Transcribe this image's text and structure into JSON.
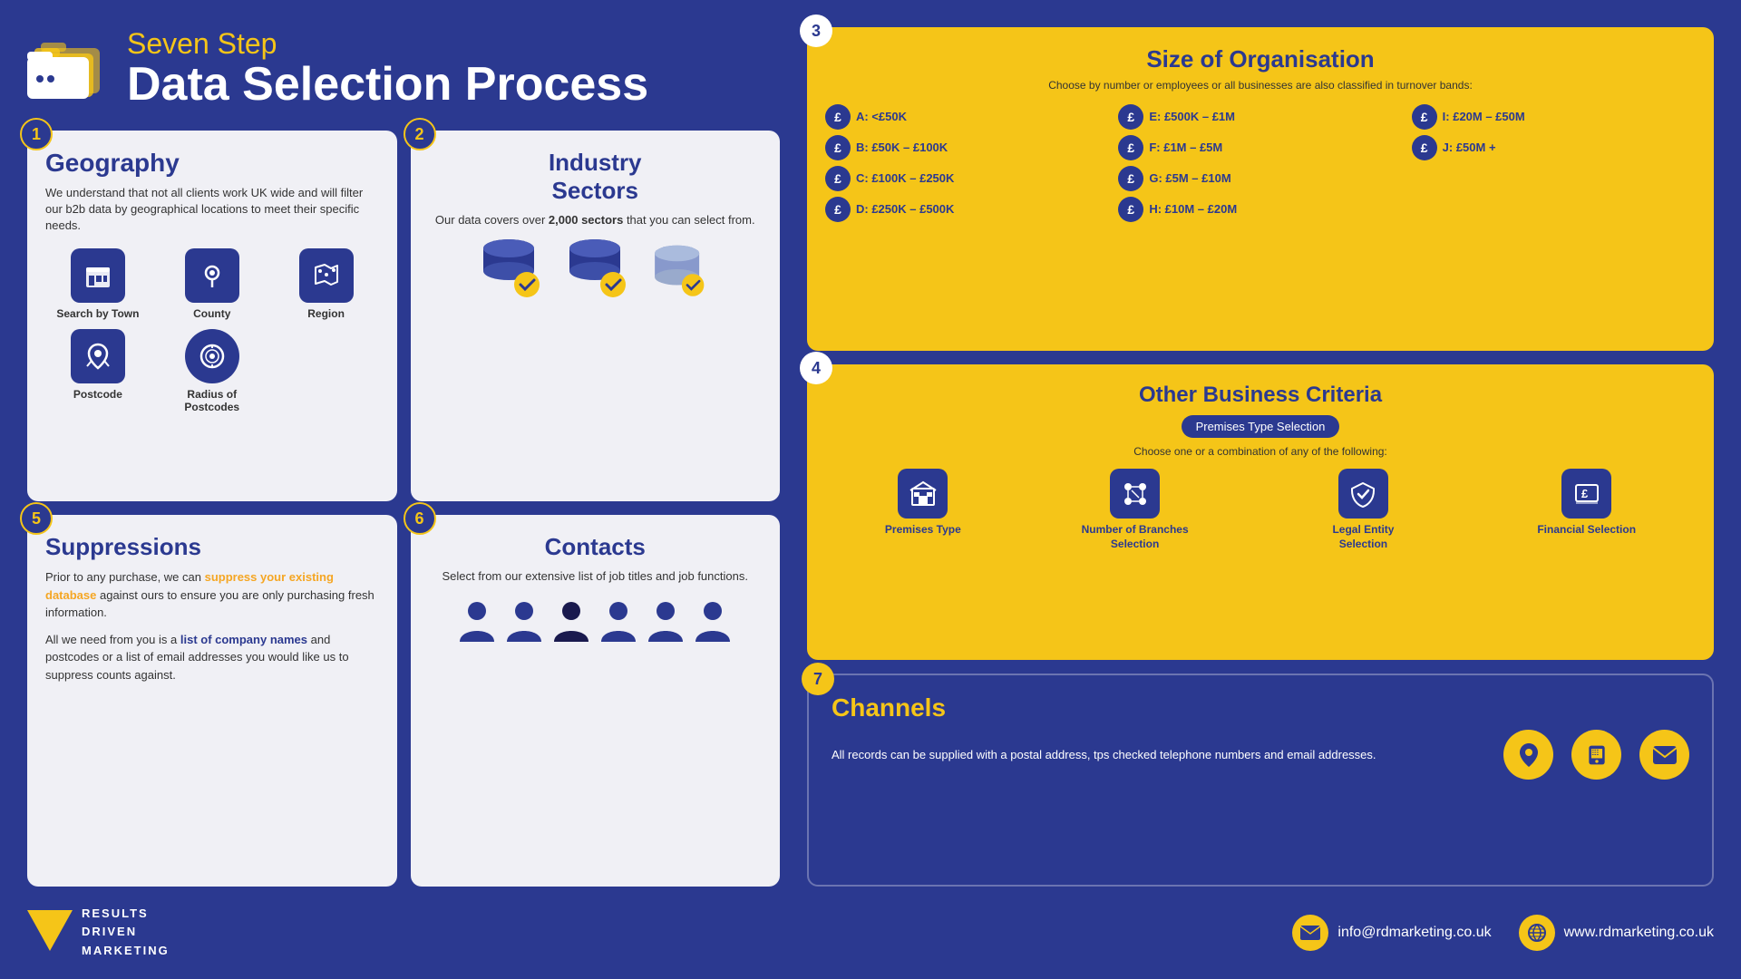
{
  "header": {
    "subtitle": "Seven Step",
    "title": "Data Selection Process"
  },
  "step1": {
    "number": "1",
    "title": "Geography",
    "description": "We understand that not all clients work UK wide and will filter our b2b data by geographical locations to meet their specific needs.",
    "icons": [
      {
        "label": "Search by Town",
        "icon": "🏢"
      },
      {
        "label": "County",
        "icon": "📍"
      },
      {
        "label": "Region",
        "icon": "🗺"
      },
      {
        "label": "Postcode",
        "icon": "📮"
      },
      {
        "label": "Radius of Postcodes",
        "icon": "🎯"
      }
    ]
  },
  "step2": {
    "number": "2",
    "title": "Industry Sectors",
    "description": "Our data covers over 2,000 sectors that you can select from."
  },
  "step3": {
    "number": "3",
    "title": "Size of Organisation",
    "subtitle": "Choose by number or employees or all businesses are also classified in turnover bands:",
    "bands": [
      {
        "label": "A: <£50K"
      },
      {
        "label": "B: £50K – £100K"
      },
      {
        "label": "C: £100K – £250K"
      },
      {
        "label": "D: £250K – £500K"
      },
      {
        "label": "E: £500K – £1M"
      },
      {
        "label": "F: £1M – £5M"
      },
      {
        "label": "G: £5M – £10M"
      },
      {
        "label": "H: £10M – £20M"
      },
      {
        "label": "I: £20M – £50M"
      },
      {
        "label": "J: £50M +"
      }
    ]
  },
  "step4": {
    "number": "4",
    "title": "Other Business Criteria",
    "badge": "Premises Type Selection",
    "choose_text": "Choose one or a combination of any of the following:",
    "options": [
      {
        "label": "Premises Type",
        "icon": "🏢"
      },
      {
        "label": "Number of Branches Selection",
        "icon": "🔀"
      },
      {
        "label": "Legal Entity Selection",
        "icon": "⚖"
      },
      {
        "label": "Financial Selection",
        "icon": "💷"
      }
    ]
  },
  "step5": {
    "number": "5",
    "title": "Suppressions",
    "para1": "Prior to any purchase, we can suppress your existing database against ours to ensure you are only purchasing fresh information.",
    "highlight1": "suppress your existing database",
    "para2_start": "All we need from you is a ",
    "highlight2": "list of company names",
    "para2_end": " and postcodes or a list of email addresses you would like us to suppress counts against."
  },
  "step6": {
    "number": "6",
    "title": "Contacts",
    "description": "Select from our extensive list of job titles and job functions."
  },
  "step7": {
    "number": "7",
    "title": "Channels",
    "description": "All records can be supplied with a postal address, tps checked telephone numbers and email addresses."
  },
  "footer": {
    "logo_lines": [
      "RESULTS",
      "DRIVEN",
      "MARKETING"
    ],
    "email": "info@rdmarketing.co.uk",
    "website": "www.rdmarketing.co.uk"
  }
}
